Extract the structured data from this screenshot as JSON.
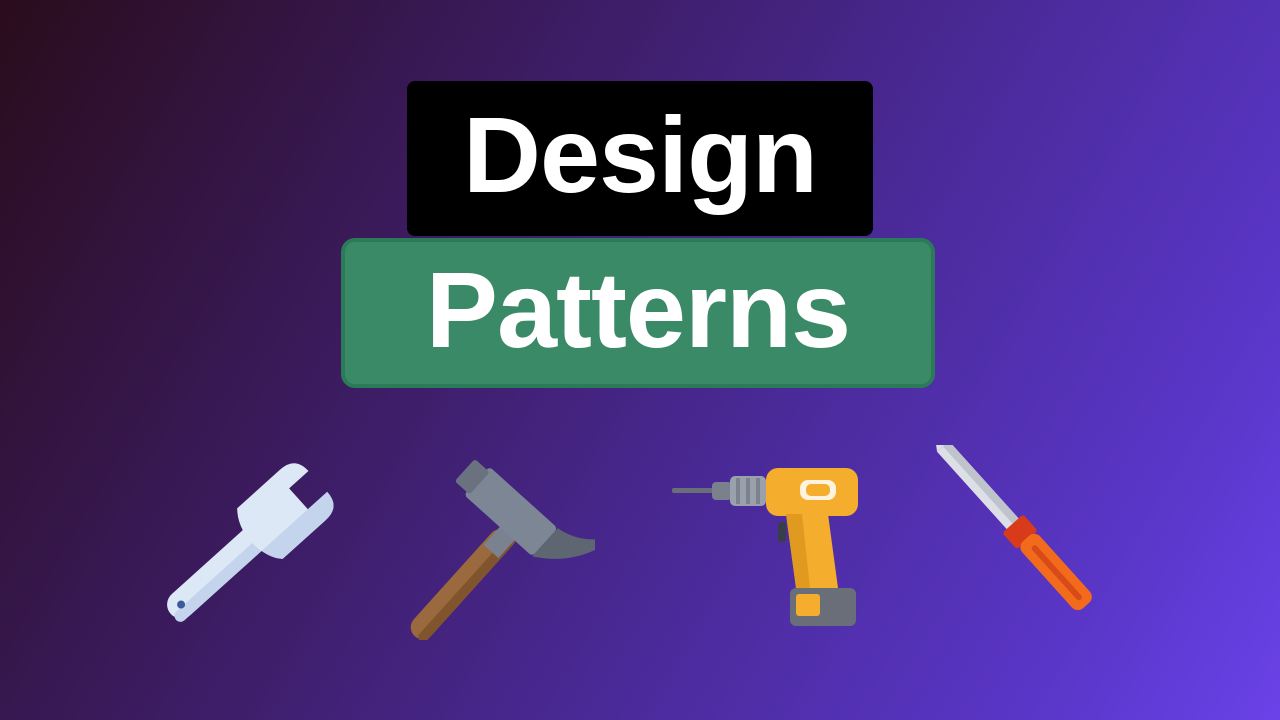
{
  "title": {
    "line1": "Design",
    "line2": "Patterns"
  },
  "tools": [
    {
      "icon": "wrench-icon"
    },
    {
      "icon": "hammer-icon"
    },
    {
      "icon": "drill-icon"
    },
    {
      "icon": "screwdriver-icon"
    }
  ],
  "colors": {
    "title_bg": "#000000",
    "subtitle_bg": "#3a8a68",
    "text": "#ffffff"
  }
}
